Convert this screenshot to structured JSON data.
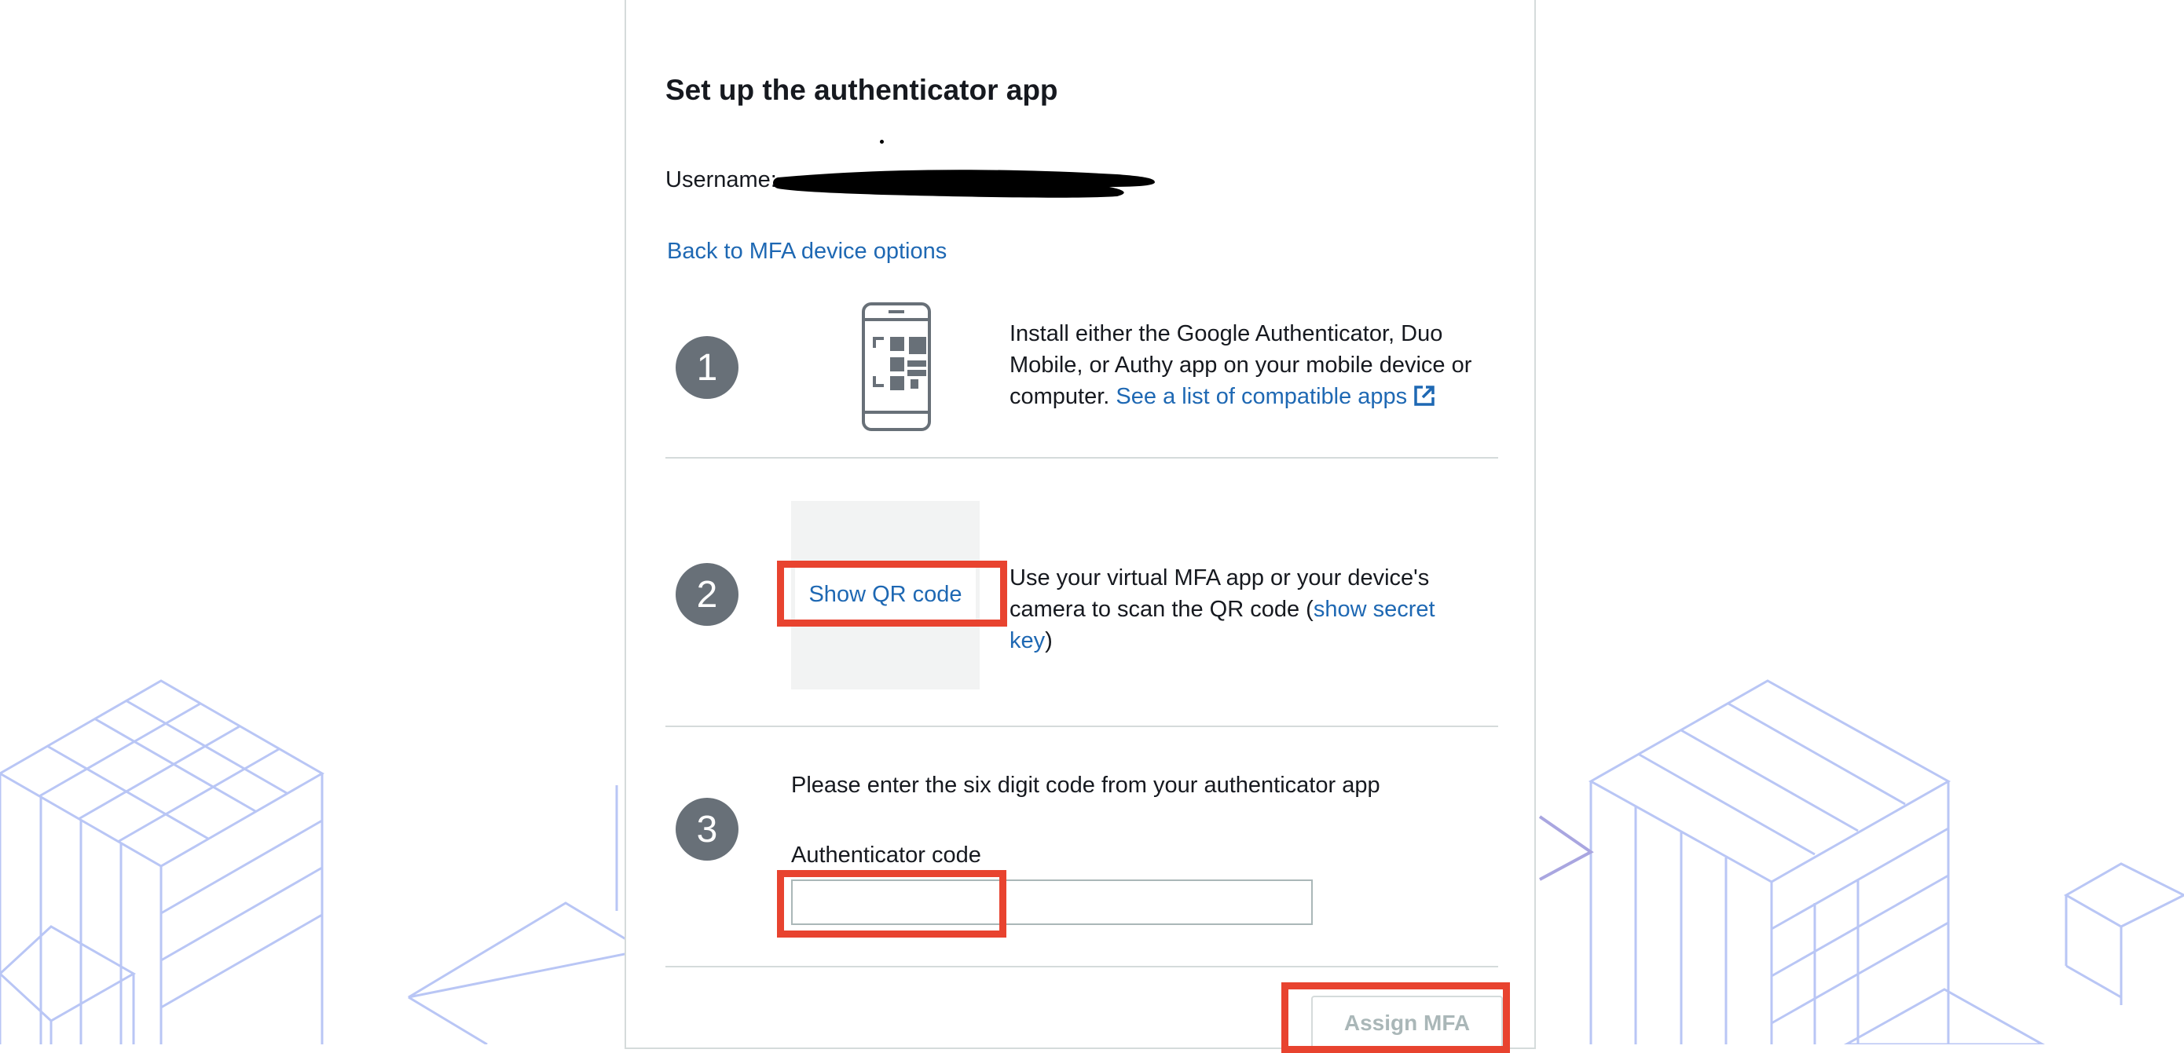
{
  "setup": {
    "title": "Set up the authenticator app",
    "username_label": "Username:",
    "back_link": "Back to MFA device options"
  },
  "steps": [
    {
      "number": "1",
      "text": "Install either the Google Authenticator, Duo Mobile, or Authy app on your mobile device or computer.",
      "link": "See a list of compatible apps",
      "icon": "phone-qr-icon"
    },
    {
      "number": "2",
      "button": "Show QR code",
      "text": "Use your virtual MFA app or your device's camera to scan the QR code (",
      "link": "show secret key",
      "text_end": ")"
    },
    {
      "number": "3",
      "text": "Please enter the six digit code from your authenticator app",
      "field_label": "Authenticator code",
      "field_value": ""
    }
  ],
  "actions": {
    "assign": "Assign MFA"
  },
  "colors": {
    "link": "#1e68b3",
    "highlight": "#e8432f",
    "step_circle": "#687078",
    "decoration": "#b9c6f5"
  }
}
